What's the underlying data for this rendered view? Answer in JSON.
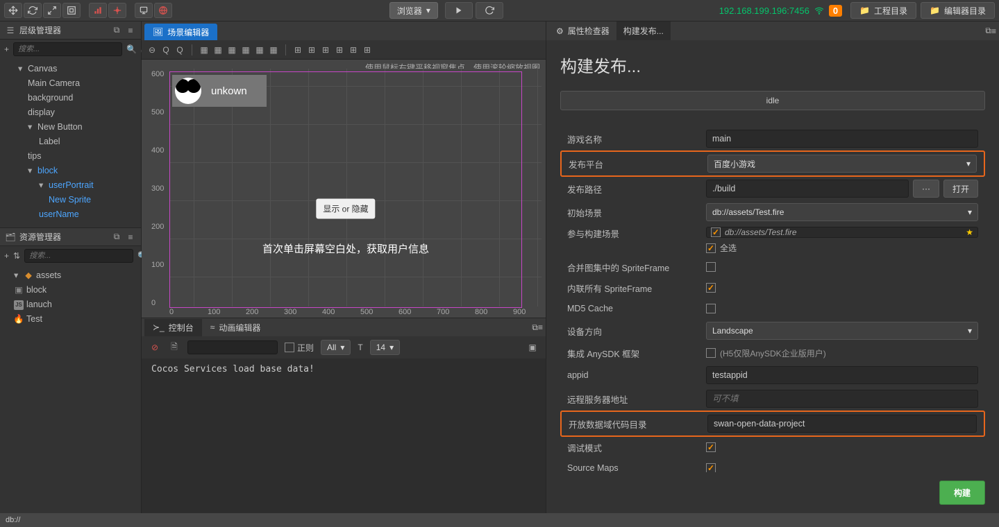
{
  "toolbar": {
    "preview_dropdown": "浏览器",
    "ip": "192.168.199.196:7456",
    "wifi_count": "0",
    "project_dir": "工程目录",
    "editor_dir": "编辑器目录"
  },
  "hierarchy": {
    "title": "层级管理器",
    "search_placeholder": "搜索...",
    "items": {
      "canvas": "Canvas",
      "main_camera": "Main Camera",
      "background": "background",
      "display": "display",
      "new_button": "New Button",
      "label": "Label",
      "tips": "tips",
      "block": "block",
      "user_portrait": "userPortrait",
      "new_sprite": "New Sprite",
      "user_name": "userName"
    }
  },
  "assets": {
    "title": "资源管理器",
    "search_placeholder": "搜索...",
    "items": {
      "root": "assets",
      "block": "block",
      "launch": "lanuch",
      "test": "Test"
    }
  },
  "scene": {
    "tab": "场景编辑器",
    "hint": "使用鼠标右键平移视窗焦点，使用滚轮缩放视图",
    "ruler_y": [
      "600",
      "500",
      "400",
      "300",
      "200",
      "100",
      "0"
    ],
    "ruler_x": [
      "0",
      "100",
      "200",
      "300",
      "400",
      "500",
      "600",
      "700",
      "800",
      "900"
    ],
    "username": "unkown",
    "btn_label": "显示 or 隐藏",
    "center_text": "首次单击屏幕空白处，获取用户信息"
  },
  "console": {
    "tab_console": "控制台",
    "tab_anim": "动画编辑器",
    "regex_label": "正则",
    "filter_all": "All",
    "font_size": "14",
    "log": "Cocos Services load base data!"
  },
  "inspector": {
    "tab_inspector": "属性检查器",
    "tab_build": "构建发布...",
    "title": "构建发布...",
    "status": "idle",
    "labels": {
      "game_name": "游戏名称",
      "platform": "发布平台",
      "path": "发布路径",
      "init_scene": "初始场景",
      "build_scenes": "参与构建场景",
      "select_all": "全选",
      "merge_sf": "合并图集中的 SpriteFrame",
      "inline_sf": "内联所有 SpriteFrame",
      "md5": "MD5 Cache",
      "orient": "设备方向",
      "anysdk": "集成 AnySDK 框架",
      "anysdk_note": "(H5仅限AnySDK企业版用户)",
      "appid": "appid",
      "remote": "远程服务器地址",
      "remote_placeholder": "可不填",
      "open_data": "开放数据域代码目录",
      "debug": "调试模式",
      "source_maps": "Source Maps"
    },
    "values": {
      "game_name": "main",
      "platform": "百度小游戏",
      "path": "./build",
      "btn_dots": "···",
      "btn_open": "打开",
      "init_scene": "db://assets/Test.fire",
      "scene_item": "db://assets/Test.fire",
      "orient": "Landscape",
      "appid": "testappid",
      "open_data": "swan-open-data-project"
    },
    "build_btn": "构建"
  },
  "footer": {
    "path": "db://"
  }
}
